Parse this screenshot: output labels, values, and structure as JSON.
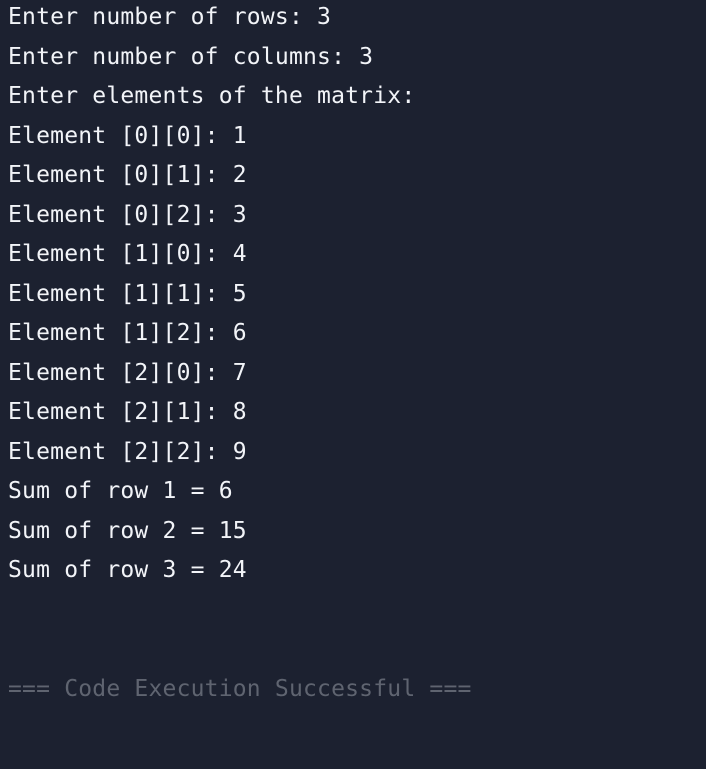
{
  "console": {
    "lines": [
      "Enter number of rows: 3",
      "Enter number of columns: 3",
      "Enter elements of the matrix:",
      "Element [0][0]: 1",
      "Element [0][1]: 2",
      "Element [0][2]: 3",
      "Element [1][0]: 4",
      "Element [1][1]: 5",
      "Element [1][2]: 6",
      "Element [2][0]: 7",
      "Element [2][1]: 8",
      "Element [2][2]: 9",
      "Sum of row 1 = 6",
      "Sum of row 2 = 15",
      "Sum of row 3 = 24"
    ],
    "status": "=== Code Execution Successful ===",
    "colors": {
      "background": "#1c2130",
      "text": "#f2f4f8",
      "status": "#5f6470"
    }
  }
}
